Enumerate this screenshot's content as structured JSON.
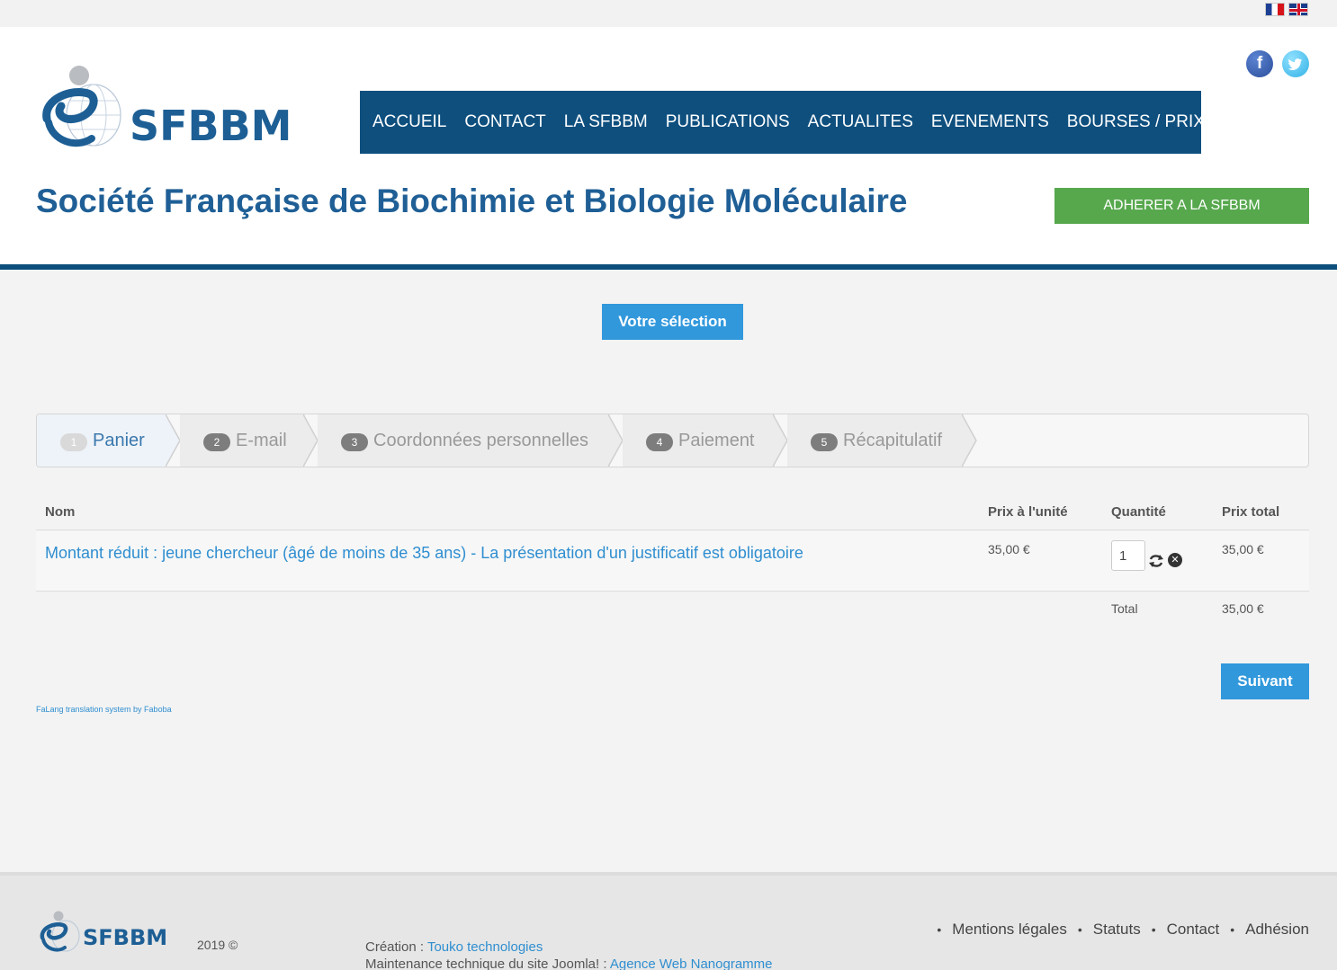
{
  "header": {
    "languages": [
      "fr",
      "en"
    ],
    "logo_text": "SFBBM",
    "social": {
      "facebook": "f",
      "twitter": "t"
    },
    "nav": [
      "ACCUEIL",
      "CONTACT",
      "LA SFBBM",
      "PUBLICATIONS",
      "ACTUALITES",
      "EVENEMENTS",
      "BOURSES / PRIX"
    ],
    "site_title": "Société Française de Biochimie et Biologie Moléculaire",
    "join_button": "ADHERER A LA SFBBM"
  },
  "content": {
    "selection_button": "Votre sélection",
    "steps": [
      {
        "num": "1",
        "label": "Panier"
      },
      {
        "num": "2",
        "label": "E-mail"
      },
      {
        "num": "3",
        "label": "Coordonnées personnelles"
      },
      {
        "num": "4",
        "label": "Paiement"
      },
      {
        "num": "5",
        "label": "Récapitulatif"
      }
    ],
    "cart": {
      "columns": {
        "name": "Nom",
        "unit_price": "Prix à l'unité",
        "quantity": "Quantité",
        "total_price": "Prix total"
      },
      "item": {
        "name": "Montant réduit : jeune chercheur (âgé de moins de 35 ans) - La présentation d'un justificatif est obligatoire",
        "unit_price": "35,00 €",
        "quantity": "1",
        "total_price": "35,00 €"
      },
      "total_label": "Total",
      "total_value": "35,00 €"
    },
    "next_button": "Suivant",
    "falang": "FaLang translation system by Faboba"
  },
  "footer": {
    "logo_text": "SFBBM",
    "year": "2019 ©",
    "creation_label": "Création : ",
    "creation_link": "Touko technologies",
    "maintenance_label": "Maintenance technique du site Joomla! : ",
    "maintenance_link": "Agence Web Nanogramme",
    "links": [
      "Mentions légales",
      "Statuts",
      "Contact",
      "Adhésion"
    ]
  },
  "colors": {
    "brand_blue": "#0e4f7e",
    "title_blue": "#1f5f96",
    "accent_blue": "#3198dc",
    "green": "#57a84d"
  }
}
